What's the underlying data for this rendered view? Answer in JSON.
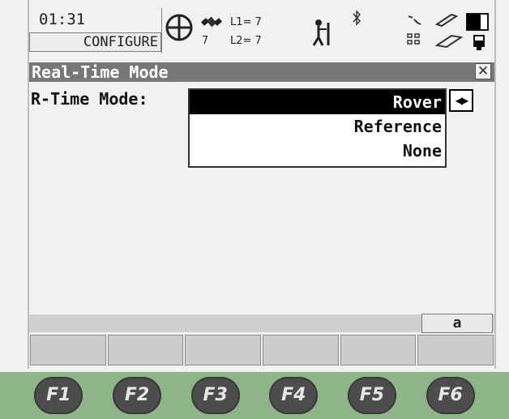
{
  "header": {
    "time": "01:31",
    "mode": "CONFIGURE",
    "l1": "L1= 7",
    "l2": "L2= 7",
    "sat_count": "7",
    "icons": [
      "position-target-icon",
      "satellite-icon",
      "person-with-pole-icon",
      "bluetooth-icon",
      "radio-icon",
      "pencil-icon",
      "battery-icon",
      "memory-card-icon",
      "network-icon",
      "storage-icon"
    ]
  },
  "dialog": {
    "title": "Real-Time Mode",
    "close_label": "✕",
    "field_label": "R-Time Mode:",
    "options": [
      "Rover",
      "Reference",
      "None"
    ],
    "selected": "Rover"
  },
  "input_mode": "a",
  "softkeys": [
    "",
    "",
    "",
    "",
    "",
    ""
  ],
  "fkeys": [
    "F1",
    "F2",
    "F3",
    "F4",
    "F5",
    "F6"
  ],
  "colors": {
    "titlebar": "#777777",
    "selected_bg": "#000000",
    "keypad_bg": "#8fb48a",
    "fkey_bg": "#4d4d4d"
  }
}
